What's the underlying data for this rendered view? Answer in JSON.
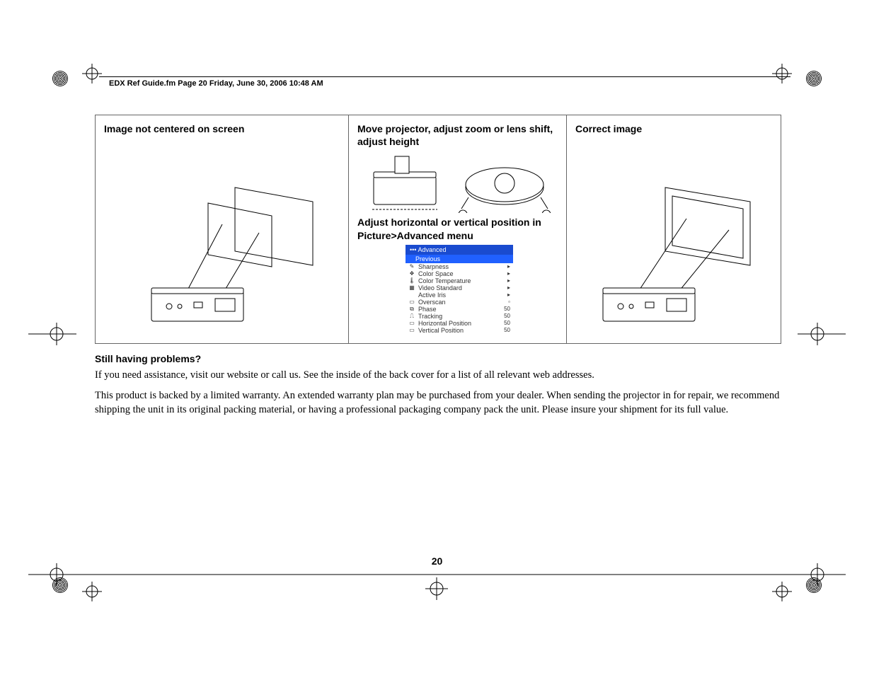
{
  "header": "EDX Ref Guide.fm  Page 20  Friday, June 30, 2006  10:48 AM",
  "cells": {
    "c1": {
      "title": "Image not centered on screen"
    },
    "c2": {
      "title": "Move projector, adjust zoom or lens shift, adjust height",
      "subhead": "Adjust horizontal or vertical position in Picture>Advanced menu"
    },
    "c3": {
      "title": "Correct image"
    }
  },
  "menu": {
    "head": "••• Advanced",
    "prev": "Previous",
    "rows": [
      {
        "icon": "✎",
        "label": "Sharpness",
        "val": "▸"
      },
      {
        "icon": "❖",
        "label": "Color Space",
        "val": "▸"
      },
      {
        "icon": "🌡",
        "label": "Color Temperature",
        "val": "▸"
      },
      {
        "icon": "▦",
        "label": "Video Standard",
        "val": "▸"
      },
      {
        "icon": " ",
        "label": "Active Iris",
        "val": "▸"
      },
      {
        "icon": "▭",
        "label": "Overscan",
        "val": "▫"
      },
      {
        "icon": "⧉",
        "label": "Phase",
        "val": "50"
      },
      {
        "icon": "⎍",
        "label": "Tracking",
        "val": "50"
      },
      {
        "icon": "▭",
        "label": "Horizontal Position",
        "val": "50"
      },
      {
        "icon": "▭",
        "label": "Vertical Position",
        "val": "50"
      }
    ]
  },
  "body": {
    "heading": "Still having problems?",
    "p1": "If you need assistance, visit our website or call us. See the inside of the back cover for a list of all relevant web addresses.",
    "p2": "This product is backed by a limited warranty. An extended warranty plan may be purchased from your dealer. When sending the projector in for repair, we recommend shipping the unit in its original packing material, or having a professional packaging company pack the unit. Please insure your shipment for its full value."
  },
  "page_number": "20"
}
